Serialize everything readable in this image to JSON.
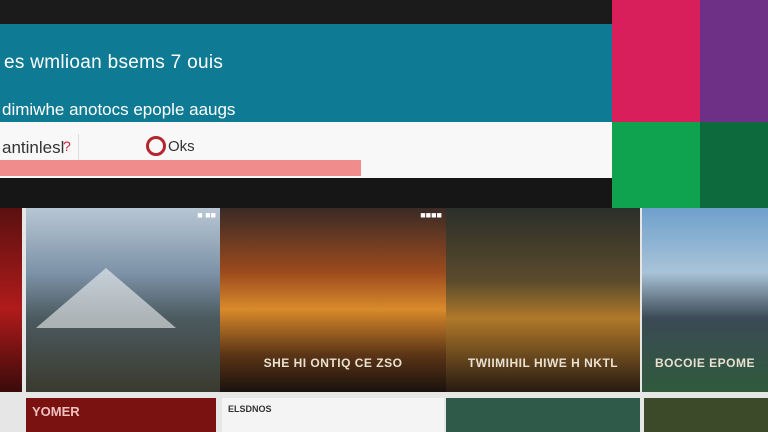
{
  "banner": {
    "line1": "es wmlioan bsems 7 ouis",
    "line2": "dimiwhe anotocs epople aaugs"
  },
  "nav": {
    "item1": "antinlesl",
    "item1_badge": "?",
    "logo_text": "Oks"
  },
  "progress": {
    "fill_fraction": 0.59
  },
  "tiles": [
    "#d81e5b",
    "#6e2f86",
    "#0fa24f",
    "#0c6a3c"
  ],
  "cards": [
    {
      "label": "",
      "corner": ""
    },
    {
      "label": "",
      "corner": "■ ■■"
    },
    {
      "label": "SHE HI ONTIQ CE ZSO",
      "corner": "■■■■"
    },
    {
      "label": "TWIIMIHIL HIWE H NKTL",
      "corner": ""
    },
    {
      "label": "BOCOIE EPOME",
      "corner": ""
    }
  ],
  "row2": [
    "YOMER",
    "ELSDNOS",
    "",
    ""
  ]
}
